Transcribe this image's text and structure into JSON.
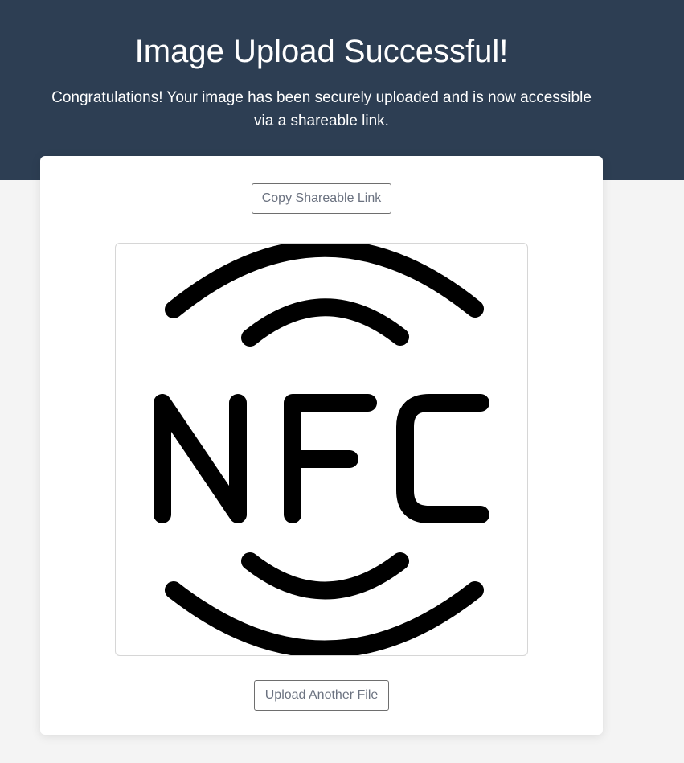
{
  "header": {
    "title": "Image Upload Successful!",
    "message": "Congratulations! Your image has been securely uploaded and is now accessible via a shareable link."
  },
  "card": {
    "copy_link_label": "Copy Shareable Link",
    "upload_another_label": "Upload Another File",
    "image": {
      "icon": "nfc-icon",
      "logo_text": "NFC"
    }
  },
  "colors": {
    "header_bg": "#2d3e53",
    "page_bg": "#f4f4f4",
    "card_bg": "#ffffff",
    "button_text": "#6b7280",
    "icon_stroke": "#000000"
  }
}
